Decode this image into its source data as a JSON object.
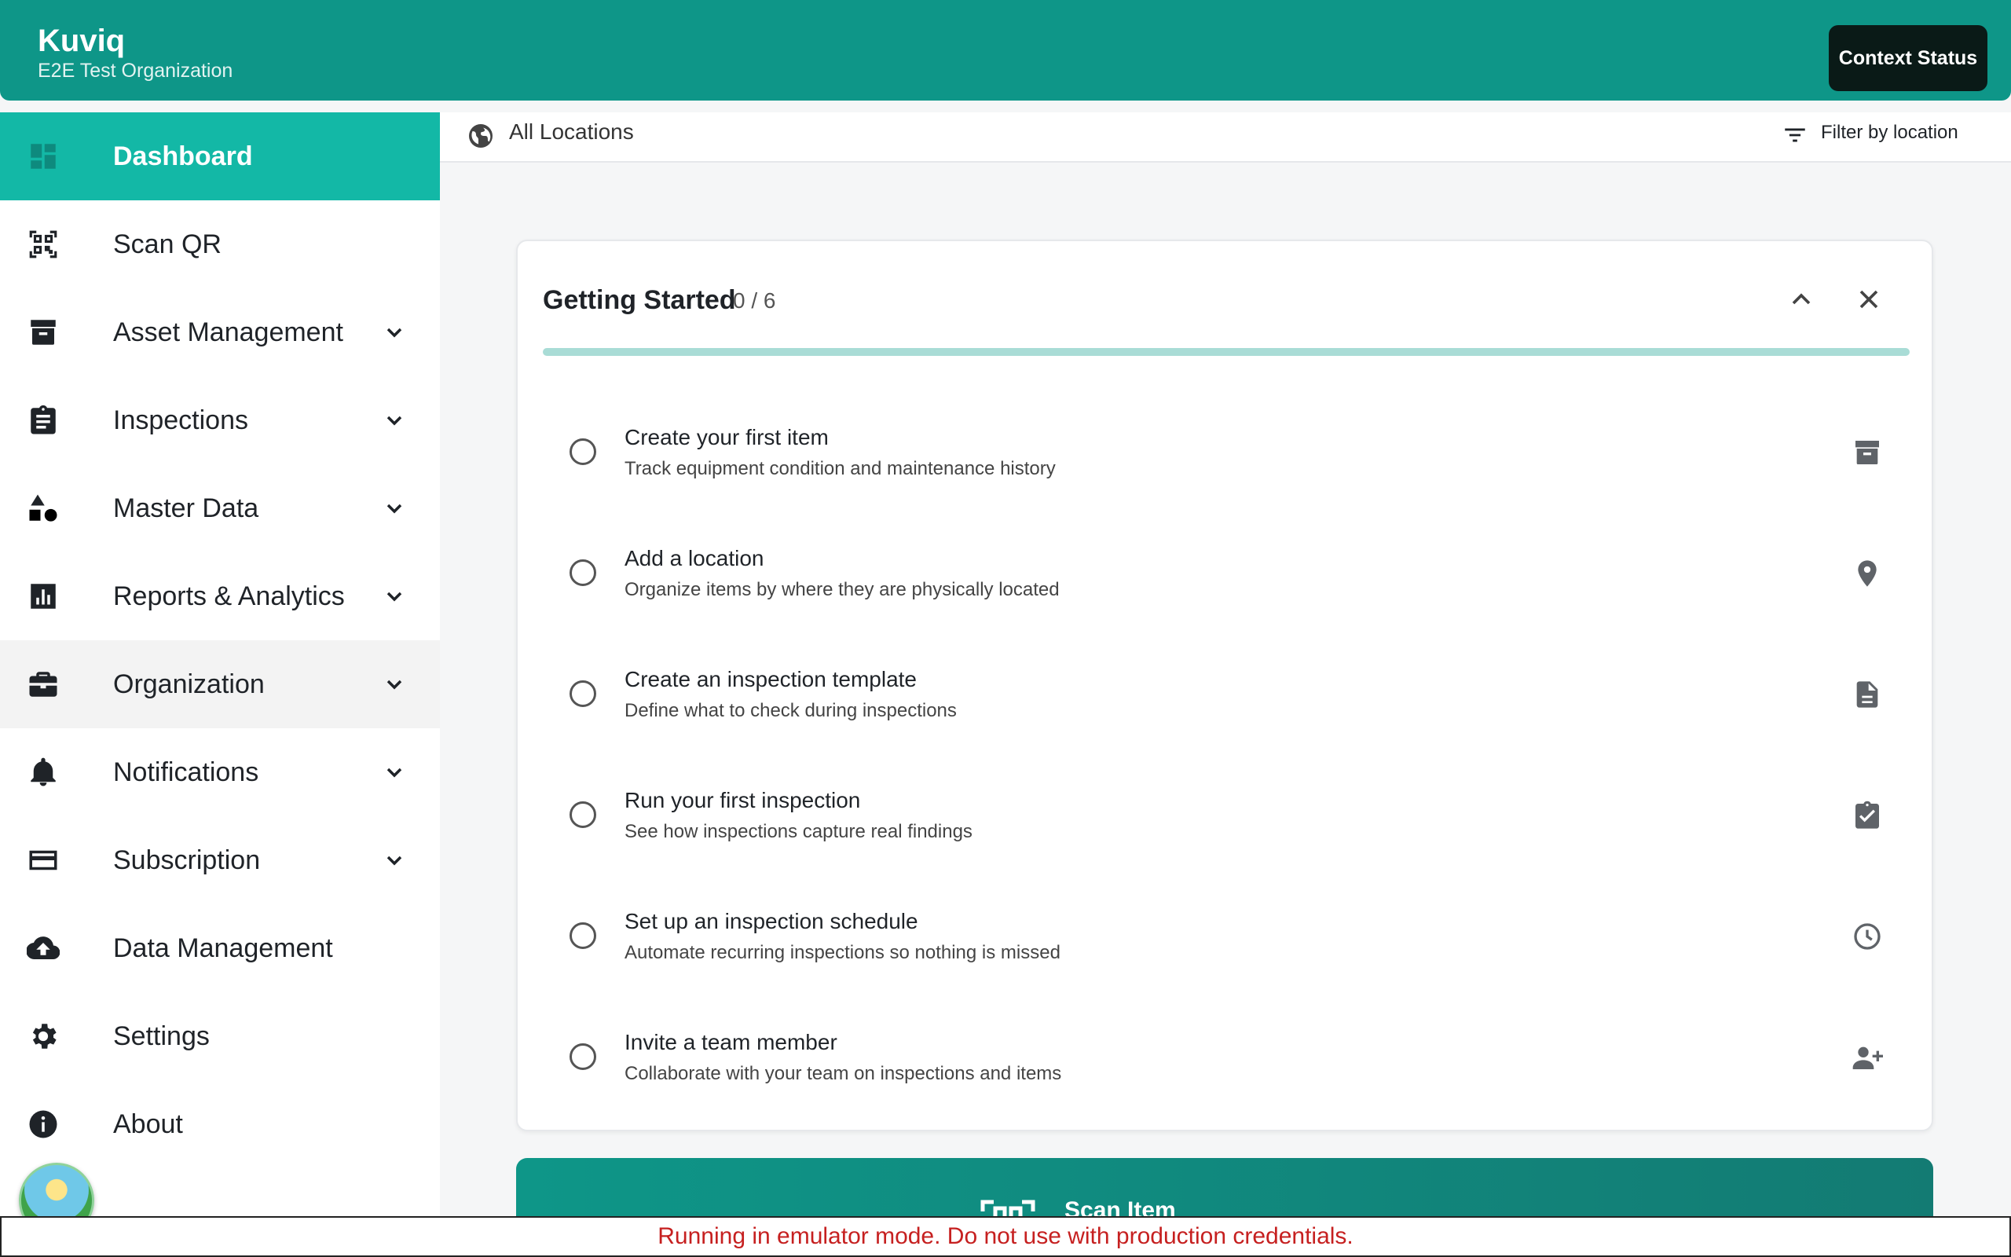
{
  "header": {
    "app_title": "Kuviq",
    "org_name": "E2E Test Organization",
    "context_status_label": "Context Status"
  },
  "sidebar": {
    "items": [
      {
        "label": "Dashboard",
        "icon": "dashboard-icon",
        "expandable": false,
        "active": true
      },
      {
        "label": "Scan QR",
        "icon": "qr-scan-icon",
        "expandable": false
      },
      {
        "label": "Asset Management",
        "icon": "archive-box-icon",
        "expandable": true
      },
      {
        "label": "Inspections",
        "icon": "clipboard-icon",
        "expandable": true
      },
      {
        "label": "Master Data",
        "icon": "shapes-icon",
        "expandable": true
      },
      {
        "label": "Reports & Analytics",
        "icon": "bar-chart-icon",
        "expandable": true
      },
      {
        "label": "Organization",
        "icon": "briefcase-icon",
        "expandable": true
      },
      {
        "label": "Notifications",
        "icon": "bell-icon",
        "expandable": true
      },
      {
        "label": "Subscription",
        "icon": "credit-card-icon",
        "expandable": true
      },
      {
        "label": "Data Management",
        "icon": "cloud-upload-icon",
        "expandable": false
      },
      {
        "label": "Settings",
        "icon": "gear-icon",
        "expandable": false
      },
      {
        "label": "About",
        "icon": "info-icon",
        "expandable": false
      }
    ]
  },
  "location_bar": {
    "current": "All Locations",
    "filter_label": "Filter by location"
  },
  "getting_started": {
    "title": "Getting Started",
    "progress_text": "0 / 6",
    "progress_fraction": 0,
    "tasks": [
      {
        "title": "Create your first item",
        "desc": "Track equipment condition and maintenance history",
        "icon": "archive-box-icon"
      },
      {
        "title": "Add a location",
        "desc": "Organize items by where they are physically located",
        "icon": "map-pin-icon"
      },
      {
        "title": "Create an inspection template",
        "desc": "Define what to check during inspections",
        "icon": "document-icon"
      },
      {
        "title": "Run your first inspection",
        "desc": "See how inspections capture real findings",
        "icon": "clipboard-check-icon"
      },
      {
        "title": "Set up an inspection schedule",
        "desc": "Automate recurring inspections so nothing is missed",
        "icon": "clock-icon"
      },
      {
        "title": "Invite a team member",
        "desc": "Collaborate with your team on inspections and items",
        "icon": "add-user-icon"
      }
    ]
  },
  "scan_button": {
    "label": "Scan Item"
  },
  "emulator_banner": "Running in emulator mode. Do not use with production credentials.",
  "colors": {
    "brand": "#0e9688",
    "active_nav": "#13b8a6",
    "banner_text": "#c62020"
  }
}
